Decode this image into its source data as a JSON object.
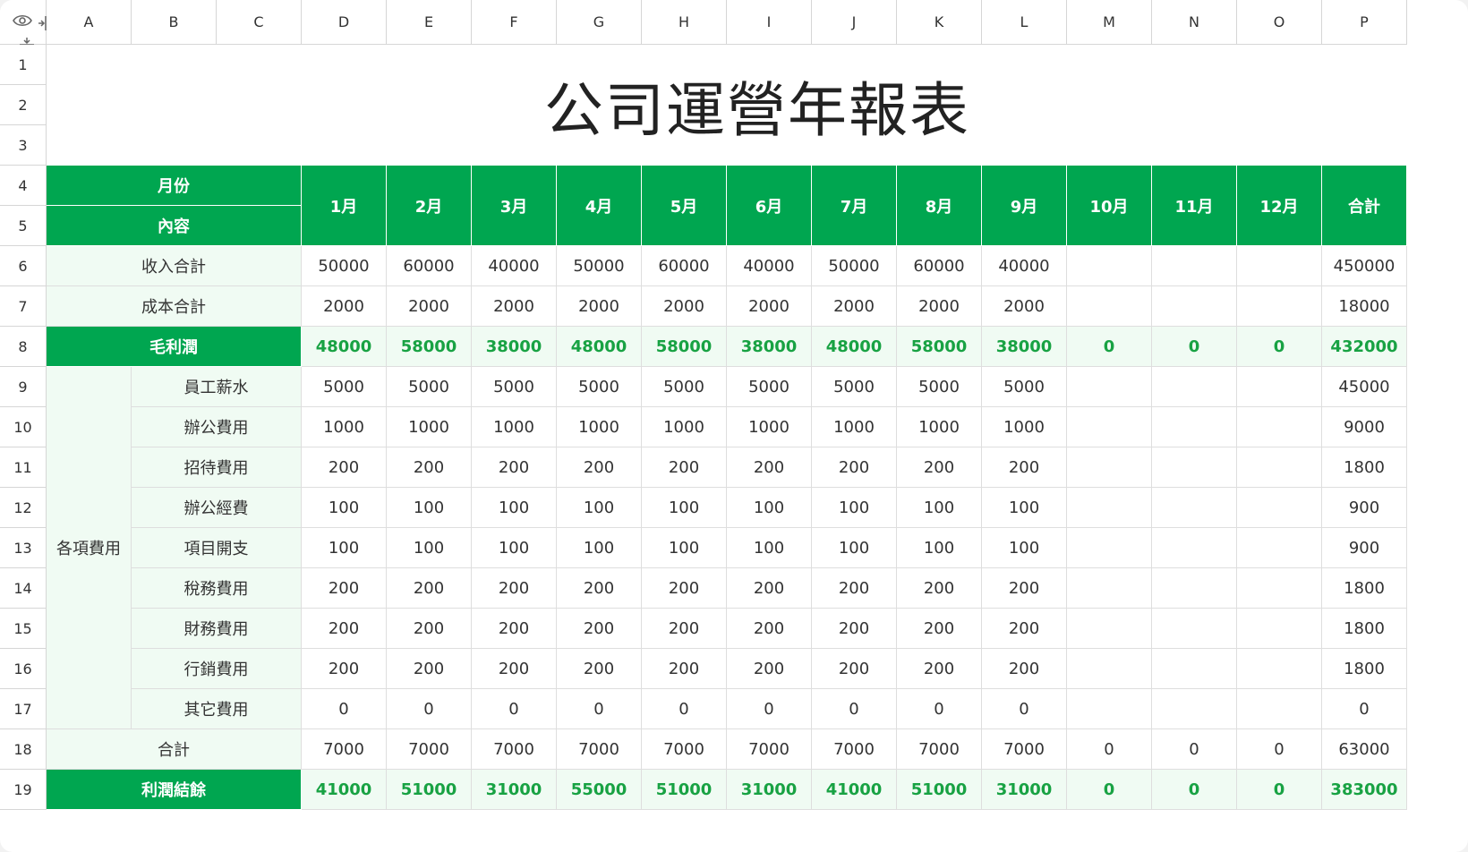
{
  "sheet": {
    "title": "公司運營年報表",
    "columns": [
      "A",
      "B",
      "C",
      "D",
      "E",
      "F",
      "G",
      "H",
      "I",
      "J",
      "K",
      "L",
      "M",
      "N",
      "O",
      "P"
    ],
    "rows": [
      "1",
      "2",
      "3",
      "4",
      "5",
      "6",
      "7",
      "8",
      "9",
      "10",
      "11",
      "12",
      "13",
      "14",
      "15",
      "16",
      "17",
      "18",
      "19"
    ],
    "header": {
      "month_label": "月份",
      "content_label": "內容",
      "months": [
        "1月",
        "2月",
        "3月",
        "4月",
        "5月",
        "6月",
        "7月",
        "8月",
        "9月",
        "10月",
        "11月",
        "12月"
      ],
      "total_label": "合計"
    },
    "income": {
      "label": "收入合計",
      "values": [
        "50000",
        "60000",
        "40000",
        "50000",
        "60000",
        "40000",
        "50000",
        "60000",
        "40000",
        "",
        "",
        ""
      ],
      "total": "450000"
    },
    "cost": {
      "label": "成本合計",
      "values": [
        "2000",
        "2000",
        "2000",
        "2000",
        "2000",
        "2000",
        "2000",
        "2000",
        "2000",
        "",
        "",
        ""
      ],
      "total": "18000"
    },
    "gross": {
      "label": "毛利潤",
      "values": [
        "48000",
        "58000",
        "38000",
        "48000",
        "58000",
        "38000",
        "48000",
        "58000",
        "38000",
        "0",
        "0",
        "0"
      ],
      "total": "432000"
    },
    "expenses_group_label": "各項費用",
    "expenses": [
      {
        "label": "員工薪水",
        "values": [
          "5000",
          "5000",
          "5000",
          "5000",
          "5000",
          "5000",
          "5000",
          "5000",
          "5000",
          "",
          "",
          ""
        ],
        "total": "45000"
      },
      {
        "label": "辦公費用",
        "values": [
          "1000",
          "1000",
          "1000",
          "1000",
          "1000",
          "1000",
          "1000",
          "1000",
          "1000",
          "",
          "",
          ""
        ],
        "total": "9000"
      },
      {
        "label": "招待費用",
        "values": [
          "200",
          "200",
          "200",
          "200",
          "200",
          "200",
          "200",
          "200",
          "200",
          "",
          "",
          ""
        ],
        "total": "1800"
      },
      {
        "label": "辦公經費",
        "values": [
          "100",
          "100",
          "100",
          "100",
          "100",
          "100",
          "100",
          "100",
          "100",
          "",
          "",
          ""
        ],
        "total": "900"
      },
      {
        "label": "項目開支",
        "values": [
          "100",
          "100",
          "100",
          "100",
          "100",
          "100",
          "100",
          "100",
          "100",
          "",
          "",
          ""
        ],
        "total": "900"
      },
      {
        "label": "稅務費用",
        "values": [
          "200",
          "200",
          "200",
          "200",
          "200",
          "200",
          "200",
          "200",
          "200",
          "",
          "",
          ""
        ],
        "total": "1800"
      },
      {
        "label": "財務費用",
        "values": [
          "200",
          "200",
          "200",
          "200",
          "200",
          "200",
          "200",
          "200",
          "200",
          "",
          "",
          ""
        ],
        "total": "1800"
      },
      {
        "label": "行銷費用",
        "values": [
          "200",
          "200",
          "200",
          "200",
          "200",
          "200",
          "200",
          "200",
          "200",
          "",
          "",
          ""
        ],
        "total": "1800"
      },
      {
        "label": "其它費用",
        "values": [
          "0",
          "0",
          "0",
          "0",
          "0",
          "0",
          "0",
          "0",
          "0",
          "",
          "",
          ""
        ],
        "total": "0"
      }
    ],
    "expense_total": {
      "label": "合計",
      "values": [
        "7000",
        "7000",
        "7000",
        "7000",
        "7000",
        "7000",
        "7000",
        "7000",
        "7000",
        "0",
        "0",
        "0"
      ],
      "total": "63000"
    },
    "profit": {
      "label": "利潤結餘",
      "values": [
        "41000",
        "51000",
        "31000",
        "55000",
        "51000",
        "31000",
        "41000",
        "51000",
        "31000",
        "0",
        "0",
        "0"
      ],
      "total": "383000"
    }
  },
  "icons": {
    "visibility": "eye-icon",
    "col_resize": "column-resize-icon",
    "row_resize": "row-resize-icon"
  },
  "colors": {
    "header_green": "#00a650",
    "value_green": "#18a243",
    "light_green": "#f0fbf3"
  }
}
